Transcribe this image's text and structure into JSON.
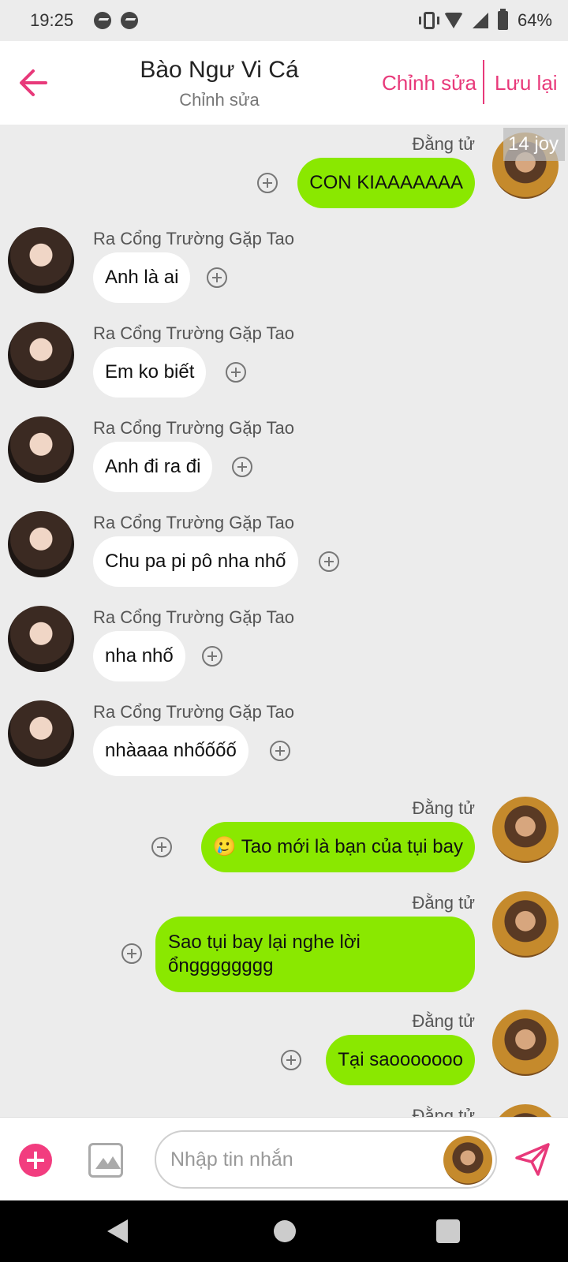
{
  "status_bar": {
    "time": "19:25",
    "battery": "64%"
  },
  "header": {
    "title": "Bào Ngư Vi Cá",
    "subtitle": "Chỉnh sửa",
    "edit_label": "Chỉnh sửa",
    "save_label": "Lưu lại"
  },
  "badge": "14 joy",
  "messages": [
    {
      "side": "right",
      "sender": "Đằng tử",
      "text": "CON KIAAAAAAA"
    },
    {
      "side": "left",
      "sender": "Ra Cổng Trường Gặp Tao",
      "text": "Anh là ai"
    },
    {
      "side": "left",
      "sender": "Ra Cổng Trường Gặp Tao",
      "text": "Em ko biết"
    },
    {
      "side": "left",
      "sender": "Ra Cổng Trường Gặp Tao",
      "text": "Anh đi ra đi"
    },
    {
      "side": "left",
      "sender": "Ra Cổng Trường Gặp Tao",
      "text": "Chu pa pi pô nha nhố"
    },
    {
      "side": "left",
      "sender": "Ra Cổng Trường Gặp Tao",
      "text": "nha nhố"
    },
    {
      "side": "left",
      "sender": "Ra Cổng Trường Gặp Tao",
      "text": "nhàaaa nhốốốố"
    },
    {
      "side": "right",
      "sender": "Đằng tử",
      "text": "🥲 Tao mới là bạn của tụi bay"
    },
    {
      "side": "right",
      "sender": "Đằng tử",
      "text": "Sao tụi bay lại nghe lời ổngggggggg"
    },
    {
      "side": "right",
      "sender": "Đằng tử",
      "text": "Tại saooooooo"
    },
    {
      "side": "right",
      "sender": "Đằng tử",
      "text": ""
    }
  ],
  "composer": {
    "placeholder": "Nhập tin nhắn"
  },
  "colors": {
    "accent": "#e8397a",
    "own_bubble": "#8ae800",
    "other_bubble": "#ffffff",
    "background": "#ececec"
  }
}
